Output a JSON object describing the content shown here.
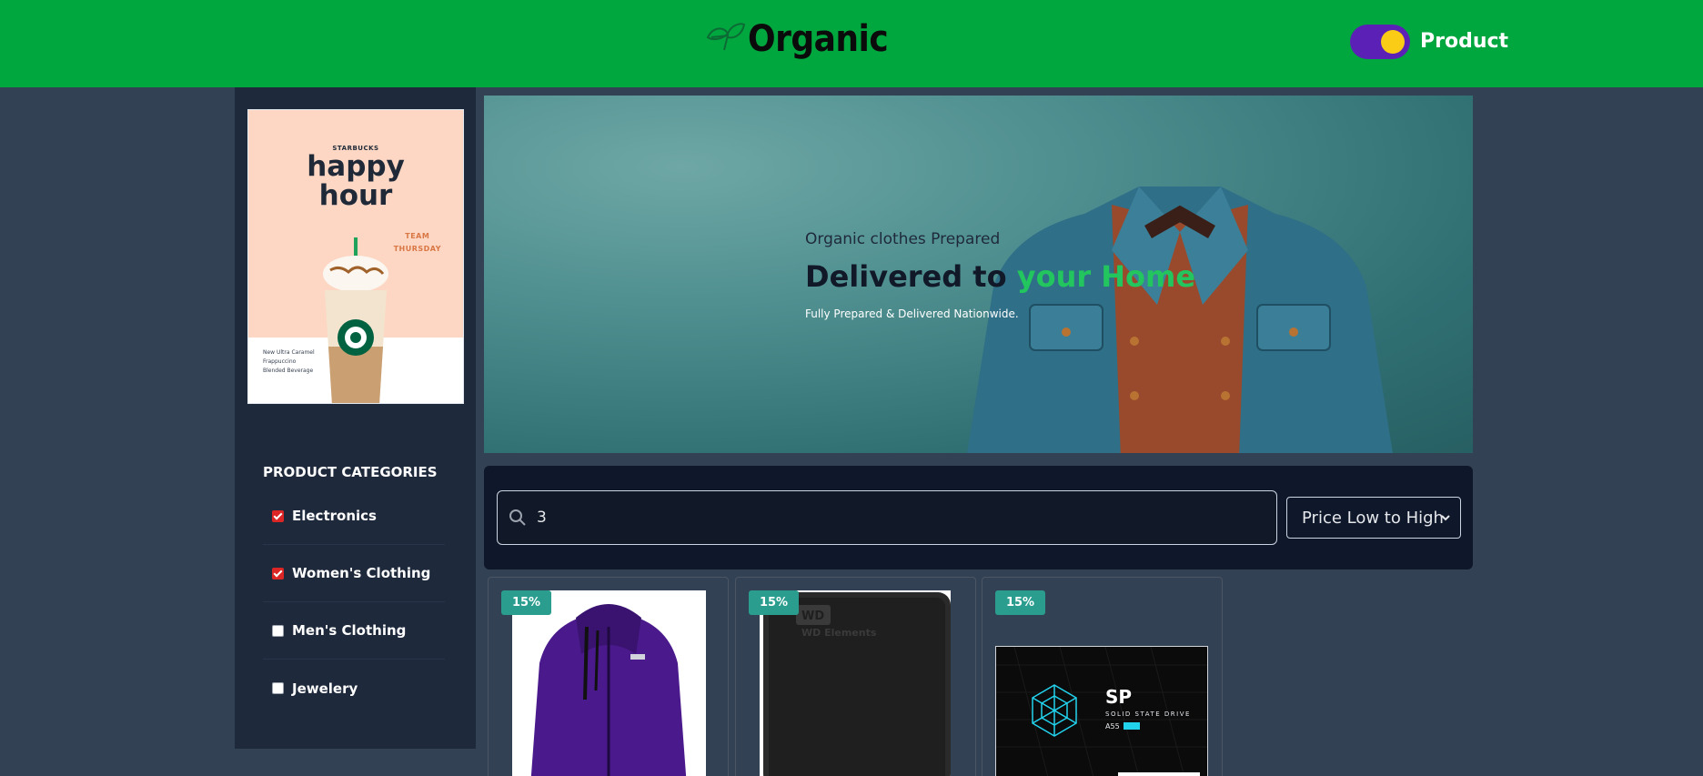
{
  "header": {
    "logo_text": "Organic",
    "toggle_label": "Product"
  },
  "sidebar": {
    "ad": {
      "brand": "STARBUCKS",
      "title_line1": "happy",
      "title_line2": "hour",
      "tag_line1": "TEAM",
      "tag_line2": "THURSDAY",
      "desc_line1": "New Ultra Caramel",
      "desc_line2": "Frappuccino",
      "desc_line3": "Blended Beverage"
    },
    "categories_title": "PRODUCT CATEGORIES",
    "categories": [
      {
        "label": "Electronics",
        "checked": true
      },
      {
        "label": "Women's Clothing",
        "checked": true
      },
      {
        "label": "Men's Clothing",
        "checked": false
      },
      {
        "label": "Jewelery",
        "checked": false
      }
    ]
  },
  "hero": {
    "small_text": "Organic clothes Prepared",
    "big_text": "Delivered to ",
    "big_accent": "your Home",
    "sub_text": "Fully Prepared & Delivered Nationwide."
  },
  "search": {
    "value": "3",
    "sort_selected": "Price Low to High"
  },
  "products": [
    {
      "discount": "15%",
      "image": "purple-jacket"
    },
    {
      "discount": "15%",
      "image": "wd-hard-drive",
      "image_text": "WD Elements"
    },
    {
      "discount": "15%",
      "image": "sp-ssd",
      "image_text_line1": "SP",
      "image_text_line2": "SOLID STATE DRIVE",
      "image_text_line3": "A55",
      "image_text_line4": "256"
    }
  ],
  "colors": {
    "header_bg": "#00a63e",
    "page_bg": "#334155",
    "sidebar_bg": "#1e293b",
    "accent_green": "#22c55e",
    "discount_badge": "#2a9d8f",
    "toggle_bg": "#5b21b6",
    "toggle_knob": "#facc15"
  }
}
